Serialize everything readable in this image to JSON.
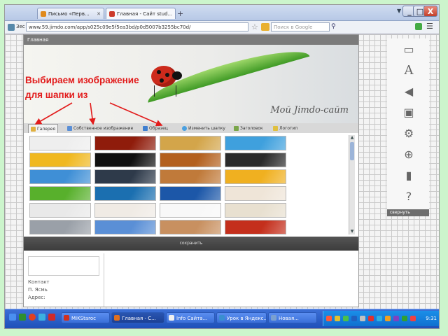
{
  "browser": {
    "tabs": [
      {
        "label": "Письмо «Перв..."
      },
      {
        "label": "Главная - Сайт stud..."
      }
    ],
    "new_tab": "+",
    "window_buttons": {
      "minimize": "_",
      "maximize": "□",
      "close": "X"
    },
    "address_label": "Зес",
    "address_url": "www.59.jimdo.com/app/s025c09e5f5ea3bd/p0d5007b3255bc70d/",
    "search_placeholder": "Поиск в Google"
  },
  "site": {
    "nav_label": "Главная",
    "title": "Мой Jimdo-сайт",
    "annotation_line1": "Выбираем изображение",
    "annotation_line2": "для шапки из"
  },
  "panel": {
    "tabs": [
      {
        "label": "Галерея"
      },
      {
        "label": "Собственное изображение"
      },
      {
        "label": "Образец"
      },
      {
        "label": "Изменить шапку"
      },
      {
        "label": "Заголовок"
      },
      {
        "label": "Логотип"
      }
    ],
    "save_label": "сохранить"
  },
  "gallery": {
    "rows": [
      [
        "#eeeeee",
        "#8f1c0b",
        "#d3a54a",
        "#3fa0dd"
      ],
      [
        "#f0b820",
        "#101010",
        "#b3601e",
        "#2a2a2a"
      ],
      [
        "#3f8fd6",
        "#2e3a4a",
        "#c07a3a",
        "#f0b020"
      ],
      [
        "#58b02c",
        "#1b6fb0",
        "#1c57a8",
        "#efe5d8"
      ],
      [
        "#e9e9e9",
        "#f0ebe5",
        "#f8f8f8",
        "#e8e0d0"
      ],
      [
        "#9aa0a8",
        "#5a8fd6",
        "#c89060",
        "#c42f1c"
      ]
    ]
  },
  "sidebar": {
    "contacts_label": "Контакт",
    "contacts_line2": "П. Ясмь",
    "address_label": "Адрес:"
  },
  "right_toolbar": {
    "icons": [
      "layout-icon",
      "text-style-icon",
      "megaphone-icon",
      "box-icon",
      "gear-icon",
      "zoom-icon",
      "stats-icon",
      "help-icon"
    ],
    "collapse_label": "свернуть"
  },
  "taskbar": {
    "tasks": [
      {
        "label": "MIKStaroc"
      },
      {
        "label": "Главная - С..."
      },
      {
        "label": "Info Сайта..."
      },
      {
        "label": "Урок в Яндекс..."
      },
      {
        "label": "Новая..."
      }
    ],
    "clock": "9:31"
  },
  "colors": {
    "desktop": "#ccf5cc",
    "annotation": "#e21b1b",
    "taskbar": "#1d4fb8"
  }
}
